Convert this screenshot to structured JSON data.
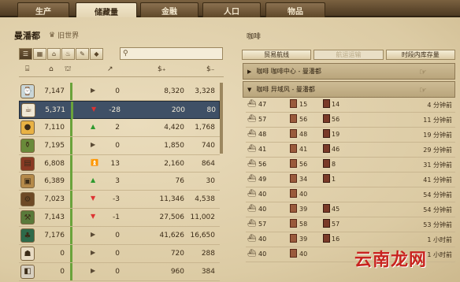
{
  "top_tabs": [
    "生产",
    "储藏量",
    "金融",
    "人口",
    "物品"
  ],
  "city": {
    "name": "曼潘都",
    "region_icon": "crown-icon",
    "region": "旧世界"
  },
  "filters": [
    "list",
    "grid",
    "factory",
    "food",
    "tools",
    "goods"
  ],
  "search": {
    "icon": "search-icon",
    "placeholder": ""
  },
  "columns": {
    "stock": "⌂",
    "trend": "↗",
    "buy": "$₊",
    "sell": "$₋"
  },
  "goods": [
    {
      "icon": "clock-icon",
      "stock": "7,147",
      "arrow": "▶",
      "change": "0",
      "buy": "8,320",
      "sell": "3,328"
    },
    {
      "icon": "coffee-icon",
      "stock": "5,371",
      "arrow": "▼",
      "change": "-28",
      "buy": "200",
      "sell": "80"
    },
    {
      "icon": "bulb-icon",
      "stock": "7,110",
      "arrow": "▲",
      "change": "2",
      "buy": "4,420",
      "sell": "1,768"
    },
    {
      "icon": "bottle-icon",
      "stock": "7,195",
      "arrow": "▶",
      "change": "0",
      "buy": "1,850",
      "sell": "740"
    },
    {
      "icon": "books-icon",
      "stock": "6,808",
      "arrow": "⏫",
      "change": "13",
      "buy": "2,160",
      "sell": "864"
    },
    {
      "icon": "box-icon",
      "stock": "6,389",
      "arrow": "▲",
      "change": "3",
      "buy": "76",
      "sell": "30"
    },
    {
      "icon": "gear-icon",
      "stock": "7,023",
      "arrow": "▼",
      "change": "-3",
      "buy": "11,346",
      "sell": "4,538"
    },
    {
      "icon": "tool-icon",
      "stock": "7,143",
      "arrow": "▼",
      "change": "-1",
      "buy": "27,506",
      "sell": "11,002"
    },
    {
      "icon": "fur-icon",
      "stock": "7,176",
      "arrow": "▶",
      "change": "0",
      "buy": "41,626",
      "sell": "16,650"
    },
    {
      "icon": "shoe-icon",
      "stock": "0",
      "arrow": "▶",
      "change": "0",
      "buy": "720",
      "sell": "288"
    },
    {
      "icon": "cloth-icon",
      "stock": "0",
      "arrow": "▶",
      "change": "0",
      "buy": "960",
      "sell": "384"
    }
  ],
  "right": {
    "title": "咖啡",
    "tabs": [
      "贸易航线",
      "航运运输",
      "时段内库存量"
    ],
    "routes": [
      "咖啡  咖啡中心 - 曼潘都",
      "咖啡  异域风 - 曼潘都"
    ],
    "shipments": [
      {
        "a": "47",
        "b": "15",
        "c": "14",
        "time": "4 分钟前"
      },
      {
        "a": "57",
        "b": "56",
        "c": "56",
        "time": "11 分钟前"
      },
      {
        "a": "48",
        "b": "48",
        "c": "19",
        "time": "19 分钟前"
      },
      {
        "a": "41",
        "b": "41",
        "c": "46",
        "time": "29 分钟前"
      },
      {
        "a": "56",
        "b": "56",
        "c": "8",
        "time": "31 分钟前"
      },
      {
        "a": "49",
        "b": "34",
        "c": "1",
        "time": "41 分钟前"
      },
      {
        "a": "40",
        "b": "40",
        "c": "",
        "time": "54 分钟前"
      },
      {
        "a": "40",
        "b": "39",
        "c": "45",
        "time": "54 分钟前"
      },
      {
        "a": "57",
        "b": "58",
        "c": "57",
        "time": "53 分钟前"
      },
      {
        "a": "40",
        "b": "39",
        "c": "16",
        "time": "1 小时前"
      },
      {
        "a": "40",
        "b": "40",
        "c": "",
        "time": "1 小时前"
      }
    ]
  },
  "watermark": "云南龙网"
}
